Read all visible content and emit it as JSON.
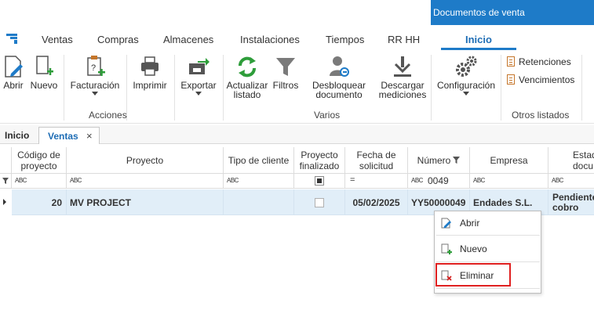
{
  "window": {
    "title": "Documentos de venta"
  },
  "menu": {
    "tabs": [
      "Ventas",
      "Compras",
      "Almacenes",
      "Instalaciones",
      "Tiempos",
      "RR HH",
      "Inicio"
    ],
    "active": "Inicio"
  },
  "ribbon": {
    "abrir": "Abrir",
    "nuevo": "Nuevo",
    "facturacion": "Facturación",
    "imprimir": "Imprimir",
    "exportar": "Exportar",
    "actualizar_1": "Actualizar",
    "actualizar_2": "listado",
    "filtros": "Filtros",
    "desbloquear_1": "Desbloquear",
    "desbloquear_2": "documento",
    "descargar_1": "Descargar",
    "descargar_2": "mediciones",
    "configuracion": "Configuración",
    "retenciones": "Retenciones",
    "vencimientos": "Vencimientos",
    "group_acciones": "Acciones",
    "group_varios": "Varios",
    "group_otros": "Otros listados"
  },
  "breadcrumb": {
    "home": "Inicio",
    "tab": "Ventas",
    "close": "×"
  },
  "grid": {
    "headers": {
      "codigo_1": "Código de",
      "codigo_2": "proyecto",
      "proyecto": "Proyecto",
      "tipo": "Tipo de cliente",
      "finalizado_1": "Proyecto",
      "finalizado_2": "finalizado",
      "fecha_1": "Fecha de",
      "fecha_2": "solicitud",
      "numero": "Número",
      "empresa": "Empresa",
      "estado_1": "Estad",
      "estado_2": "docu"
    },
    "filter": {
      "abc": "ABC",
      "fecha_op": "=",
      "numero_value": "0049"
    },
    "row": {
      "codigo": "20",
      "proyecto": "MV PROJECT",
      "tipo": "",
      "fecha": "05/02/2025",
      "numero": "YY50000049",
      "empresa": "Endades S.L.",
      "estado_1": "Pendiente",
      "estado_2": "cobro"
    }
  },
  "context_menu": {
    "items": [
      "Abrir",
      "Nuevo",
      "Eliminar"
    ],
    "highlighted": "Eliminar"
  },
  "colors": {
    "accent": "#1e7bc8",
    "row_selected": "#e1eef8",
    "highlight": "#e02020"
  }
}
